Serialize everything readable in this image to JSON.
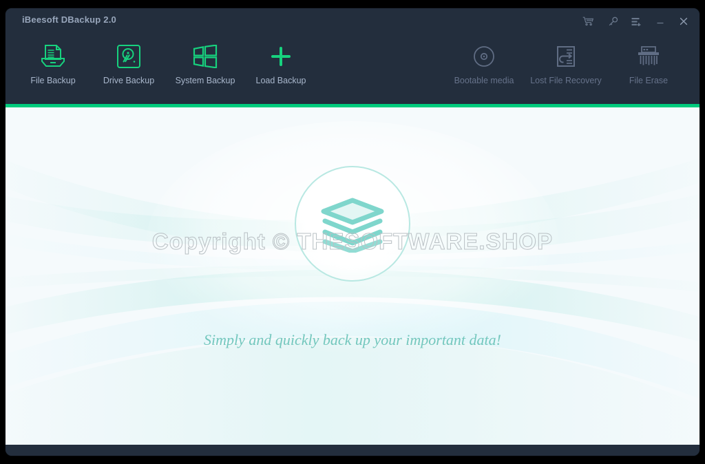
{
  "window": {
    "title": "iBeesoft DBackup 2.0",
    "accent_color": "#00cb7d",
    "titlebar_color": "#232e3d",
    "stage_color": "#f5fafc"
  },
  "window_controls": [
    {
      "name": "cart-icon",
      "label": "Buy now"
    },
    {
      "name": "key-icon",
      "label": "Register"
    },
    {
      "name": "menu-icon",
      "label": "Menu"
    },
    {
      "name": "minimize-icon",
      "label": "Minimize"
    },
    {
      "name": "close-icon",
      "label": "Close"
    }
  ],
  "toolbar": {
    "primary": [
      {
        "id": "file",
        "label": "File Backup",
        "icon": "file-backup-icon",
        "enabled": true
      },
      {
        "id": "drive",
        "label": "Drive Backup",
        "icon": "drive-backup-icon",
        "enabled": true
      },
      {
        "id": "system",
        "label": "System Backup",
        "icon": "system-backup-icon",
        "enabled": true
      },
      {
        "id": "load",
        "label": "Load Backup",
        "icon": "load-backup-icon",
        "enabled": true
      }
    ],
    "secondary": [
      {
        "id": "boot",
        "label": "Bootable media",
        "icon": "bootable-media-icon",
        "enabled": false
      },
      {
        "id": "lost",
        "label": "Lost File Recovery",
        "icon": "lost-file-recovery-icon",
        "enabled": false
      },
      {
        "id": "erase",
        "label": "File Erase",
        "icon": "file-erase-icon",
        "enabled": false
      }
    ],
    "icon_color_enabled": "#17d27e",
    "icon_color_disabled": "#606d84"
  },
  "stage": {
    "logo_icon": "stacked-layers-logo",
    "logo_color": "#7fd6cc",
    "watermark": "Copyright © THESOFTWARE.SHOP",
    "tagline": "Simply and quickly back up your important data!",
    "tagline_color": "#73c7bd"
  }
}
